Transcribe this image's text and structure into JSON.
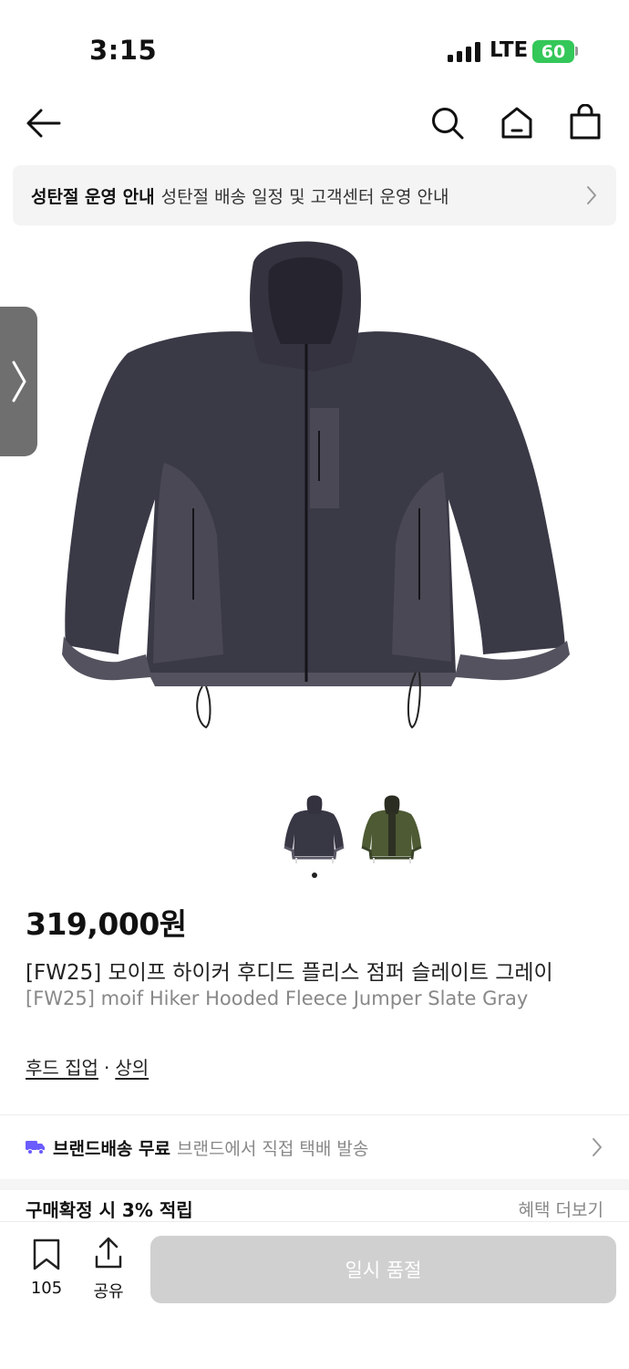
{
  "status_bar": {
    "time": "3:15",
    "network": "LTE",
    "battery": "60"
  },
  "nav": {
    "back_icon": "arrow-left-icon",
    "search_icon": "search-icon",
    "home_icon": "home-icon",
    "cart_icon": "shopping-bag-icon"
  },
  "notice": {
    "title": "성탄절 운영 안내",
    "text": "성탄절 배송 일정 및 고객센터 운영 안내"
  },
  "side_tab": {
    "icon": "chevron-right-icon"
  },
  "product": {
    "price": "319,000원",
    "title_ko": "[FW25] 모이프 하이커 후디드 플리스 점퍼 슬레이트 그레이",
    "title_en": "[FW25] moif Hiker Hooded Fleece Jumper Slate Gray",
    "categories": [
      "후드 집업",
      "상의"
    ],
    "category_separator": "·",
    "thumbnails": [
      "slate-gray",
      "olive-green"
    ]
  },
  "delivery": {
    "title": "브랜드배송 무료",
    "text": "브랜드에서 직접 택배 발송"
  },
  "points": {
    "label": "구매확정 시 3% 적립",
    "more": "혜택 더보기"
  },
  "bottom_bar": {
    "bookmark_count": "105",
    "share_label": "공유",
    "buy_label": "일시 품절"
  },
  "colors": {
    "accent_purple": "#6b5cff",
    "battery_green": "#34c759",
    "disabled_button": "#d0d0d0"
  }
}
